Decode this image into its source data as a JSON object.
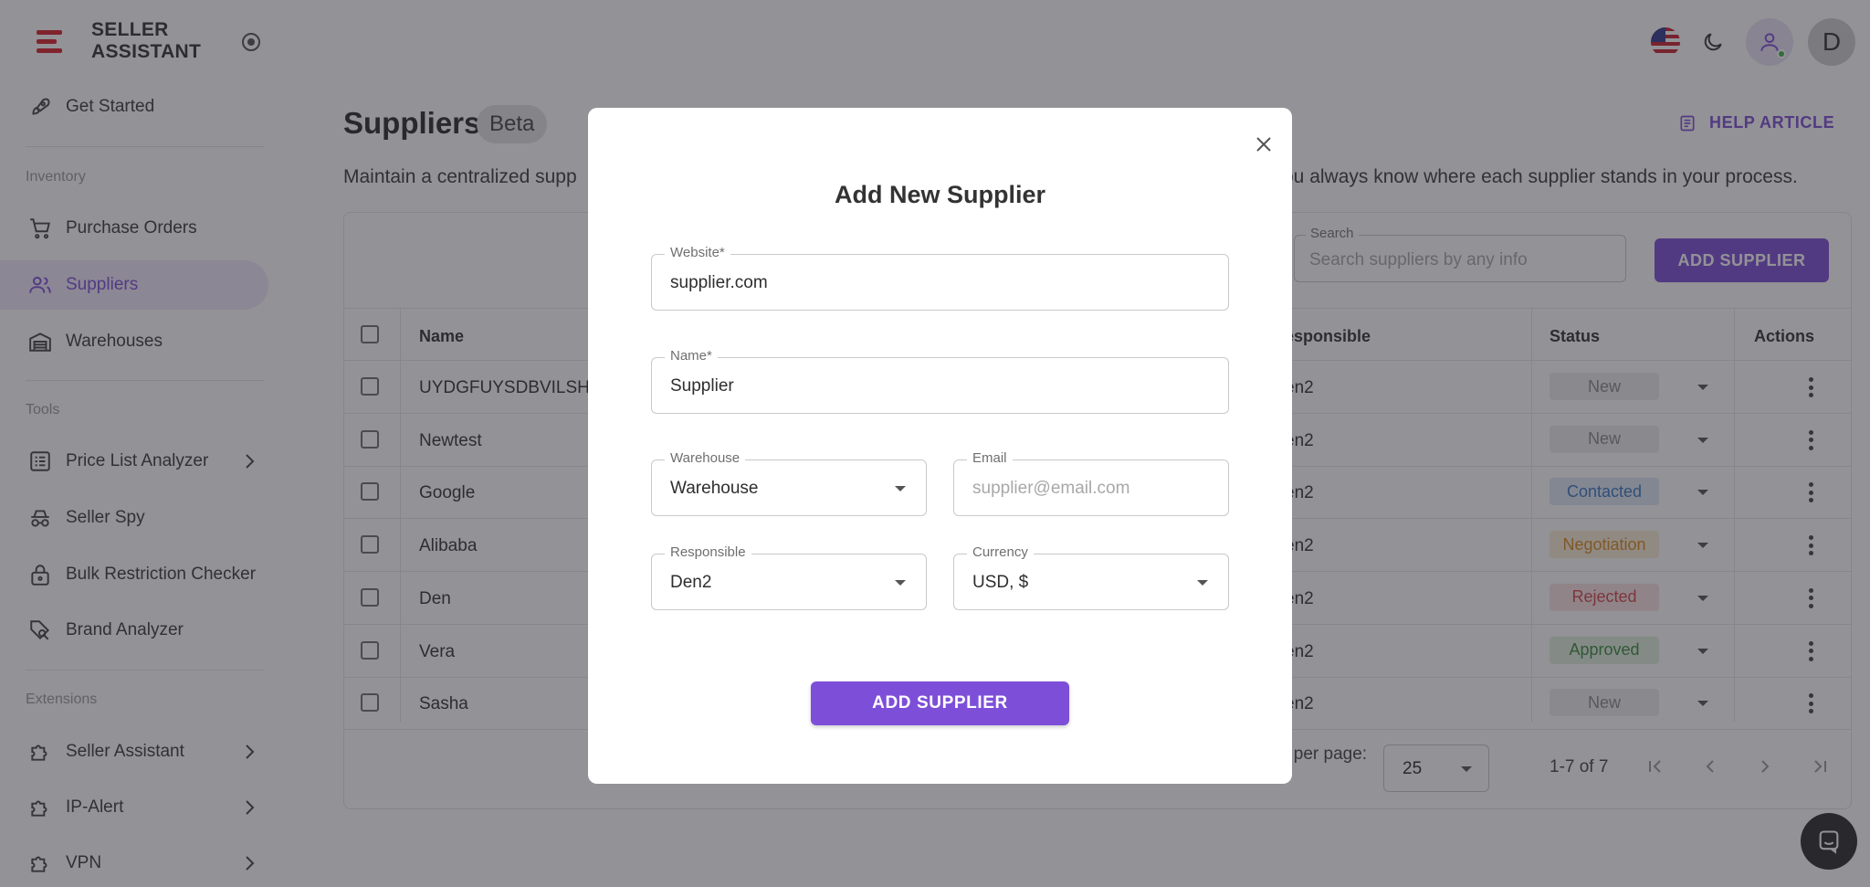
{
  "brand": {
    "line1": "SELLER",
    "line2": "ASSISTANT"
  },
  "sidebar": {
    "get_started": "Get Started",
    "section_inventory": "Inventory",
    "inventory": [
      {
        "label": "Purchase Orders",
        "icon": "cart-icon"
      },
      {
        "label": "Suppliers",
        "icon": "people-icon",
        "active": true
      },
      {
        "label": "Warehouses",
        "icon": "warehouse-icon"
      }
    ],
    "section_tools": "Tools",
    "tools": [
      {
        "label": "Price List Analyzer",
        "icon": "list-icon"
      },
      {
        "label": "Seller Spy",
        "icon": "spy-icon"
      },
      {
        "label": "Bulk Restriction Checker",
        "icon": "lock-icon"
      },
      {
        "label": "Brand Analyzer",
        "icon": "tag-search-icon"
      }
    ],
    "section_extensions": "Extensions",
    "extensions": [
      {
        "label": "Seller Assistant",
        "icon": "puzzle-icon"
      },
      {
        "label": "IP-Alert",
        "icon": "puzzle-icon"
      },
      {
        "label": "VPN",
        "icon": "puzzle-icon"
      }
    ]
  },
  "topbar": {
    "avatar_initial": "D"
  },
  "page": {
    "title": "Suppliers",
    "badge": "Beta",
    "help_link": "HELP ARTICLE",
    "description": "Maintain a centralized supp                                                                                                                  ou always know where each supplier stands in your process.",
    "desc_left": "Maintain a centralized supp",
    "desc_right": "ou always know where each supplier stands in your process."
  },
  "toolbar": {
    "search_label": "Search",
    "search_placeholder": "Search suppliers by any info",
    "add_button": "ADD SUPPLIER"
  },
  "table": {
    "headers": {
      "name": "Name",
      "responsible": "esponsible",
      "status": "Status",
      "actions": "Actions"
    },
    "rows": [
      {
        "name": "UYDGFUYSDBVILSHZ",
        "responsible": "en2",
        "status": "New"
      },
      {
        "name": "Newtest",
        "responsible": "en2",
        "status": "New"
      },
      {
        "name": "Google",
        "responsible": "en2",
        "status": "Contacted"
      },
      {
        "name": "Alibaba",
        "responsible": "en2",
        "status": "Negotiation"
      },
      {
        "name": "Den",
        "responsible": "en2",
        "status": "Rejected"
      },
      {
        "name": "Vera",
        "responsible": "en2",
        "status": "Approved"
      },
      {
        "name": "Sasha",
        "responsible": "en2",
        "status": "New"
      }
    ]
  },
  "pagination": {
    "rows_per_page_label": "s per page:",
    "rows_per_page_value": "25",
    "range": "1-7 of 7"
  },
  "status_colors": {
    "New": {
      "bg": "#ececec",
      "fg": "#8a8a8a"
    },
    "Contacted": {
      "bg": "#dde9f7",
      "fg": "#3a78c2"
    },
    "Negotiation": {
      "bg": "#fbeed9",
      "fg": "#d98a1c"
    },
    "Rejected": {
      "bg": "#f8e2e2",
      "fg": "#d2464a"
    },
    "Approved": {
      "bg": "#e1f1df",
      "fg": "#3b8a3f"
    }
  },
  "modal": {
    "title": "Add New Supplier",
    "website_label": "Website*",
    "website_value": "supplier.com",
    "name_label": "Name*",
    "name_value": "Supplier",
    "warehouse_label": "Warehouse",
    "warehouse_value": "Warehouse",
    "email_label": "Email",
    "email_placeholder": "supplier@email.com",
    "responsible_label": "Responsible",
    "responsible_value": "Den2",
    "currency_label": "Currency",
    "currency_value": "USD, $",
    "submit": "ADD SUPPLIER"
  },
  "colors": {
    "accent": "#7d4fd8",
    "brand_red": "#d6222a"
  }
}
